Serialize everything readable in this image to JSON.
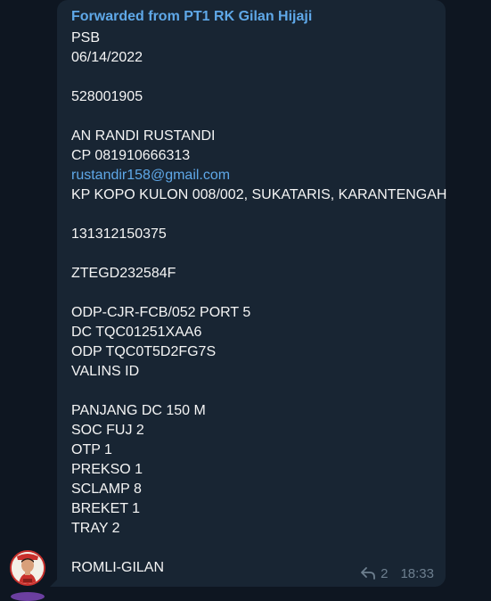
{
  "message": {
    "forwarded_from": "Forwarded from PT1 RK Gilan Hijaji",
    "lines": [
      "PSB",
      "06/14/2022",
      "",
      "528001905",
      "",
      "AN RANDI RUSTANDI",
      "CP 081910666313",
      "rustandir158@gmail.com",
      "KP KOPO KULON 008/002, SUKATARIS, KARANTENGAH",
      "",
      "131312150375",
      "",
      "ZTEGD232584F",
      "",
      "ODP-CJR-FCB/052 PORT 5",
      "DC TQC01251XAA6",
      "ODP TQC0T5D2FG7S",
      "VALINS ID",
      "",
      "PANJANG DC 150 M",
      "SOC FUJ 2",
      "OTP 1",
      "PREKSO 1",
      "SCLAMP 8",
      "BREKET 1",
      "TRAY 2",
      "",
      "ROMLI-GILAN"
    ],
    "forward_count": "2",
    "time": "18:33"
  },
  "icons": {
    "forward": "forward-arrow-icon",
    "avatar": "user-avatar"
  },
  "colors": {
    "background": "#0e1621",
    "bubble": "#182533",
    "link": "#5fa8e8",
    "text": "#f5f5f5",
    "meta": "#6d7f8f"
  }
}
